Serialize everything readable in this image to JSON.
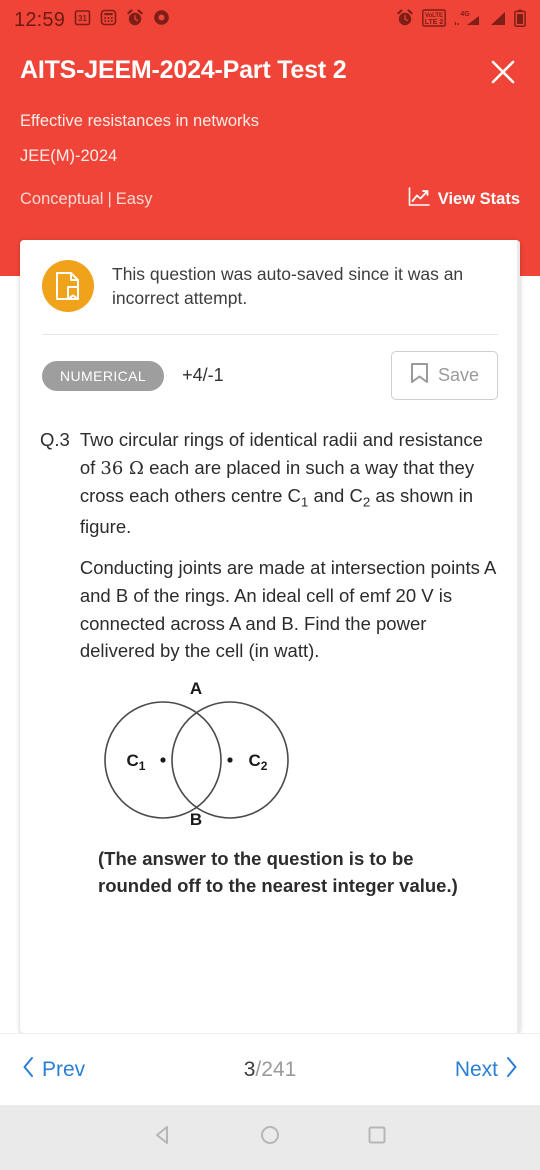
{
  "status_bar": {
    "time": "12:59",
    "left_icons": [
      "calendar-31-icon",
      "calculator-icon",
      "alarm-icon",
      "chrome-icon"
    ],
    "right_icons": [
      "alarm-icon",
      "volte-lte2-icon",
      "signal-4g-icon",
      "signal-icon",
      "battery-icon"
    ],
    "volte_label": "VoLTE",
    "lte2_label": "LTE 2",
    "network_label": "4G",
    "calendar_label": "31"
  },
  "header": {
    "title": "AITS-JEEM-2024-Part Test 2",
    "subtitle": "Effective resistances in networks",
    "exam": "JEE(M)-2024",
    "tag_type": "Conceptual",
    "tag_separator": "|",
    "tag_difficulty": "Easy",
    "view_stats_label": "View Stats",
    "close_label": "Close",
    "bg_color": "#ef4437"
  },
  "notice": {
    "text": "This question was auto-saved since it was an incorrect attempt.",
    "icon": "saved-document-bookmark-icon",
    "icon_color": "#f0a21a"
  },
  "question_meta": {
    "type_badge": "NUMERICAL",
    "marks": "+4/-1",
    "save_label": "Save",
    "badge_color": "#9e9e9e"
  },
  "question": {
    "number": "Q.3",
    "paragraph_1_part_a": "Two circular rings of identical radii and resistance of ",
    "resistance_value": "36 Ω",
    "paragraph_1_part_b": " each are placed in such a way that they cross each others centre C",
    "c1_sub": "1",
    "paragraph_1_part_c": " and C",
    "c2_sub": "2",
    "paragraph_1_part_d": " as shown in figure.",
    "paragraph_2": "Conducting joints are made at intersection points A and B of the rings. An ideal cell of emf 20 V is connected across A and B. Find the power delivered by the cell (in watt).",
    "note": "(The answer to the question is to be rounded off to the nearest integer value.)"
  },
  "figure": {
    "label_top": "A",
    "label_bottom": "B",
    "label_left_center": "C",
    "label_left_sub": "1",
    "label_right_center": "C",
    "label_right_sub": "2",
    "alt": "two overlapping circles with centres C1 and C2 intersecting at A and B"
  },
  "bottom_nav": {
    "prev_label": "Prev",
    "next_label": "Next",
    "current_page": "3",
    "total_pages": "/241",
    "link_color": "#2a7fd4"
  },
  "system_nav": {
    "back": "back-triangle-icon",
    "home": "home-circle-icon",
    "recents": "recents-square-icon"
  }
}
